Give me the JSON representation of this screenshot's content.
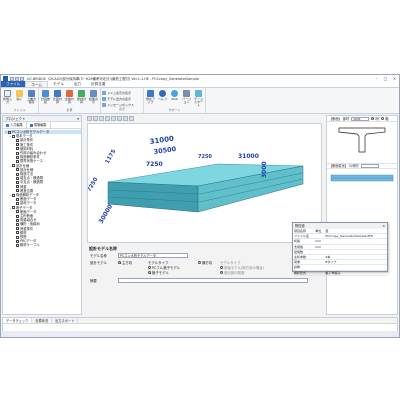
{
  "titlebar": {
    "title": "UC-BRIDGE（DCA02)部分保持車(5−H26備考対応分)(最低工程付) Ver.1.1.HE - PCCcopy_GeneratorSample"
  },
  "tabs": [
    "ファイル",
    "ホーム",
    "モデル",
    "出力",
    "計算支援"
  ],
  "ribbon": {
    "groups": [
      {
        "label": "ファイル",
        "buttons": [
          "新規入力",
          "開く",
          "上書き保存"
        ]
      },
      {
        "label": "計算",
        "buttons": [
          "計算確認",
          "比較計算",
          "全体計算",
          "部材計算",
          "結果表示"
        ]
      },
      {
        "label": "表示",
        "small": [
          "メニュ表示の表示",
          "モデル出力の表示",
          "メッセージボックス"
        ]
      },
      {
        "label": "サポート",
        "buttons": [
          "現在アップ",
          "ヘルプ",
          "Web",
          "バージョン",
          "ゲームスタート"
        ]
      }
    ]
  },
  "left": {
    "title": "プロジェクト",
    "tabs": [
      "入力編集",
      "現場編集"
    ],
    "tree": [
      {
        "label": "PCコンポ桁モデルデータ",
        "lvl": 0,
        "sel": true
      },
      {
        "label": "基本データ",
        "lvl": 1
      },
      {
        "label": "設計条件",
        "lvl": 2
      },
      {
        "label": "施工条件",
        "lvl": 2
      },
      {
        "label": "使用材料",
        "lvl": 2
      },
      {
        "label": "作用の組み合わせ",
        "lvl": 2
      },
      {
        "label": "構造解析条件",
        "lvl": 2
      },
      {
        "label": "限界状態ケース",
        "lvl": 2
      },
      {
        "label": "設計仕様",
        "lvl": 1
      },
      {
        "label": "設計仕様",
        "lvl": 2
      },
      {
        "label": "構造寸法",
        "lvl": 2
      },
      {
        "label": "端支点・横造物",
        "lvl": 2
      },
      {
        "label": "中支点・横造物",
        "lvl": 2
      },
      {
        "label": "荷重",
        "lvl": 2
      },
      {
        "label": "照査位置",
        "lvl": 2
      },
      {
        "label": "構造解析データ",
        "lvl": 1
      },
      {
        "label": "断面データ",
        "lvl": 2
      },
      {
        "label": "部材データ",
        "lvl": 2
      },
      {
        "label": "格子データ",
        "lvl": 1
      },
      {
        "label": "断面データ",
        "lvl": 2
      },
      {
        "label": "主桁断面",
        "lvl": 2
      },
      {
        "label": "荷重組合せ",
        "lvl": 2
      },
      {
        "label": "横桁・仮締め",
        "lvl": 2
      },
      {
        "label": "荷重条件",
        "lvl": 2
      },
      {
        "label": "鋼材",
        "lvl": 2
      },
      {
        "label": "鉄筋",
        "lvl": 2
      },
      {
        "label": "PRCデータ",
        "lvl": 2
      },
      {
        "label": "鋼材ケーブル",
        "lvl": 2
      }
    ]
  },
  "viewport": {
    "dims": [
      "31000",
      "30500",
      "7250",
      "7250",
      "3000",
      "1175",
      "7250",
      "31000",
      "30000"
    ]
  },
  "form": {
    "title": "設計モデル名称",
    "model_label": "モデル名称",
    "model_value": "PCコンポ桁モデルデータ",
    "model_section_label": "設計モデル",
    "opt1": "主方向",
    "opt_group_label": "モデルタイプ",
    "opt2": "PCフル格子モデル",
    "opt3": "格子モデル",
    "opt4": "横方向",
    "opt5_label": "モデルタイプ",
    "opt5": "床版モデル(斜方向の場合)",
    "opt6": "張出部の照査",
    "memo_label": "摘要"
  },
  "right": {
    "section1": "【断面】 部材",
    "sel1": "1001",
    "radio1": "I桁",
    "radio2": "箱",
    "section2": "【断面変化】 片側付"
  },
  "popup": {
    "title": "物性値",
    "headers": [
      "項目名称",
      "単位",
      "値"
    ],
    "rows": [
      [
        "ファイル名",
        "",
        "PCCcopy_GeneratorSample.PFD"
      ],
      [
        "桁長",
        "mm",
        ""
      ],
      [
        "支間長",
        "mm",
        ""
      ],
      [
        "径間数",
        "",
        ""
      ],
      [
        "主桁本数",
        "",
        "4本"
      ],
      [
        "荷重",
        "",
        "Bタイプ"
      ],
      [
        "斜角",
        "",
        ""
      ],
      [
        "解析形式",
        "",
        "格子骨組み"
      ]
    ]
  },
  "bottom": {
    "tabs": [
      "データチェック",
      "計算状況",
      "出力スポート"
    ]
  },
  "colors": {
    "ribbon_blue": "#2a64b4",
    "girder_cyan": "#5fc9d6",
    "dim_blue": "#1f3ea8"
  }
}
